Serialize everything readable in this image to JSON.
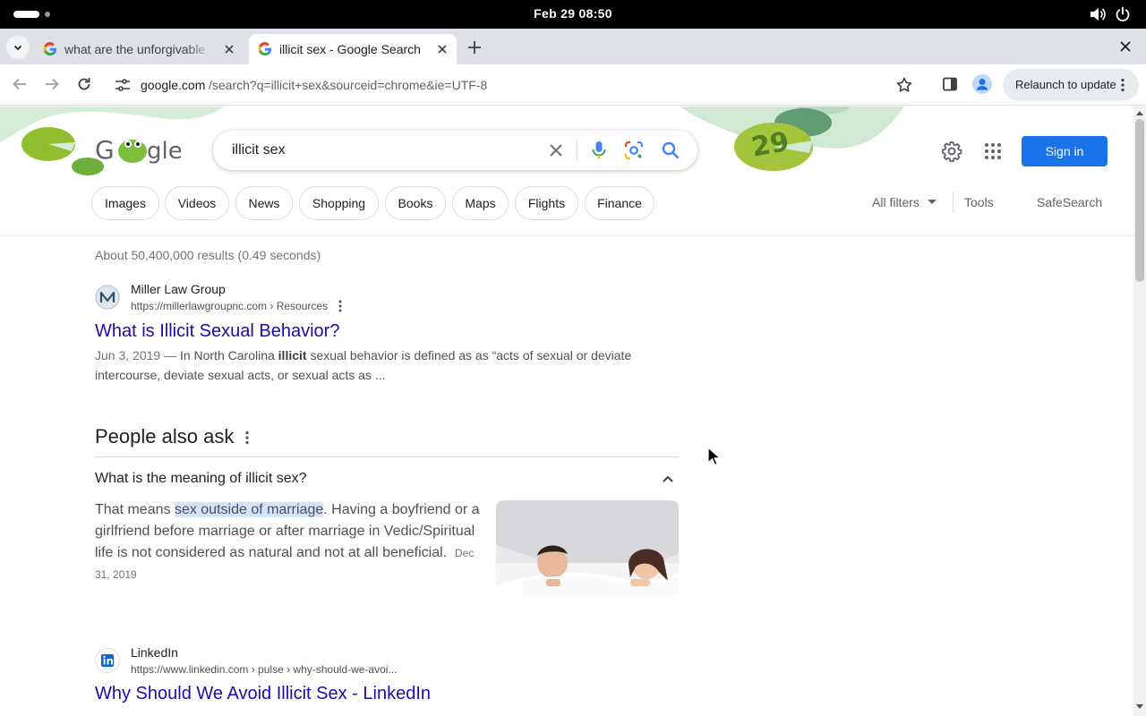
{
  "os": {
    "clock": "Feb 29  08:50"
  },
  "tabs": [
    {
      "title": "what are the unforgivable"
    },
    {
      "title": "illicit sex - Google Search"
    }
  ],
  "toolbar": {
    "url_host": "google.com",
    "url_path": "/search?q=illicit+sex&sourceid=chrome&ie=UTF-8",
    "relaunch_label": "Relaunch to update"
  },
  "search": {
    "query": "illicit sex",
    "sign_in": "Sign in",
    "doodle_number": "29"
  },
  "filters": {
    "chips": [
      "Images",
      "Videos",
      "News",
      "Shopping",
      "Books",
      "Maps",
      "Flights",
      "Finance"
    ],
    "all_filters": "All filters",
    "tools": "Tools",
    "safesearch": "SafeSearch"
  },
  "results": {
    "stats": "About 50,400,000 results (0.49 seconds)",
    "items": [
      {
        "site_name": "Miller Law Group",
        "url": "https://millerlawgroupnc.com › Resources",
        "title": "What is Illicit Sexual Behavior?",
        "snippet_date": "Jun 3, 2019 — ",
        "snippet_pre": "In North Carolina ",
        "snippet_bold": "illicit",
        "snippet_post": " sexual behavior is defined as as “acts of sexual or deviate intercourse, deviate sexual acts, or sexual acts as ..."
      },
      {
        "site_name": "LinkedIn",
        "url": "https://www.linkedin.com › pulse › why-should-we-avoi...",
        "title": "Why Should We Avoid Illicit Sex - LinkedIn"
      }
    ]
  },
  "paa": {
    "heading": "People also ask",
    "question": "What is the meaning of illicit sex?",
    "answer_pre": "That means ",
    "answer_highlight": "sex outside of marriage",
    "answer_post": ". Having a boyfriend or a girlfriend before marriage or after marriage in Vedic/Spiritual life is not considered as natural and not at all beneficial.",
    "answer_date": "Dec 31, 2019"
  },
  "colors": {
    "link": "#1a0dab",
    "accent": "#1a73e8",
    "highlight": "#d3e3fd"
  }
}
